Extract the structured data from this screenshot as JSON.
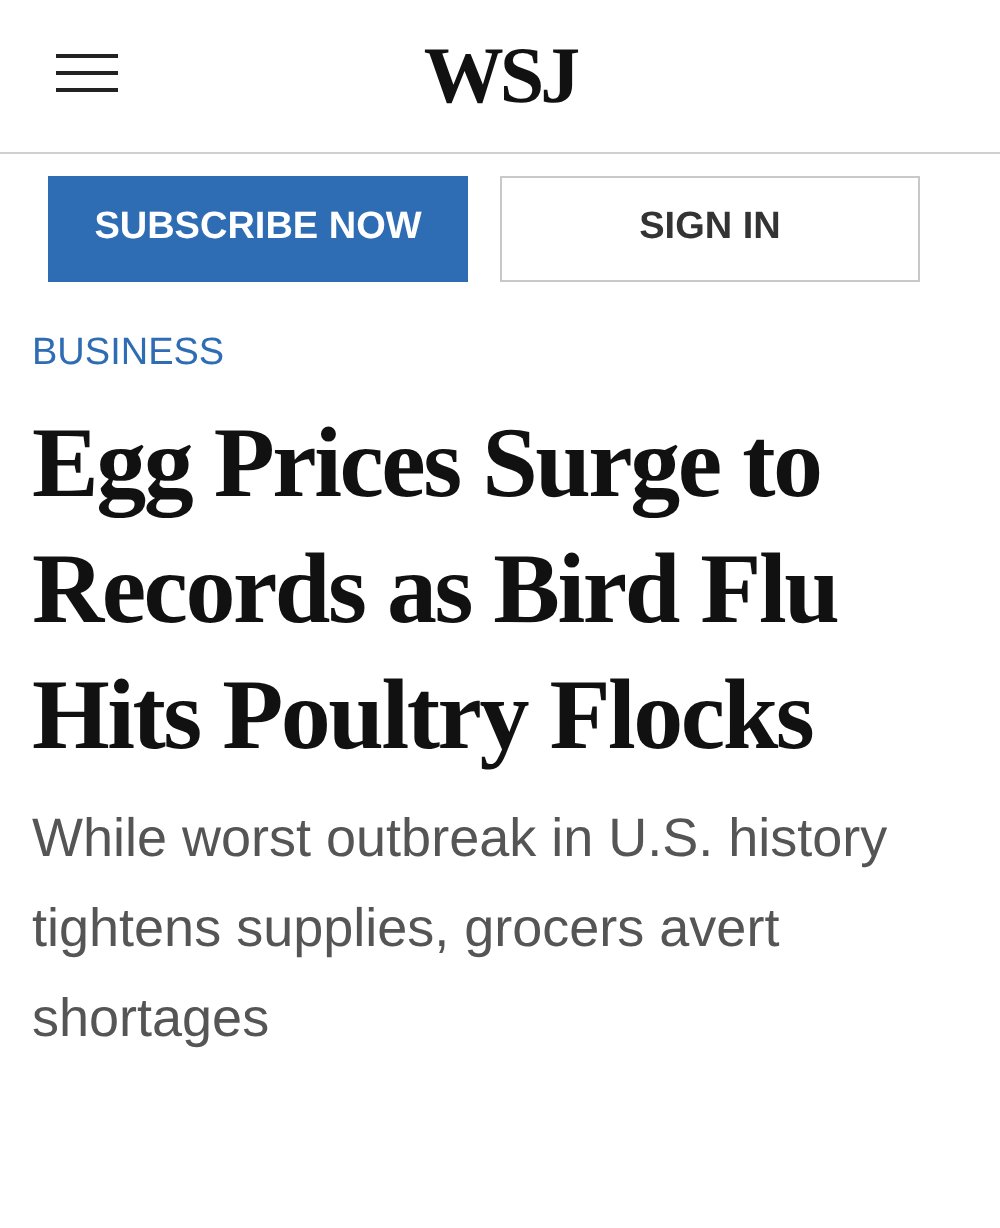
{
  "header": {
    "logo": "WSJ"
  },
  "buttons": [
    {
      "label": "SUBSCRIBE NOW",
      "kind": "primary"
    },
    {
      "label": "SIGN IN",
      "kind": "secondary"
    }
  ],
  "article": {
    "section": "BUSINESS",
    "headline": "Egg Prices Surge to Records as Bird Flu Hits Poultry Flocks",
    "dek": "While worst outbreak in U.S. history tightens supplies, grocers avert shortages"
  }
}
